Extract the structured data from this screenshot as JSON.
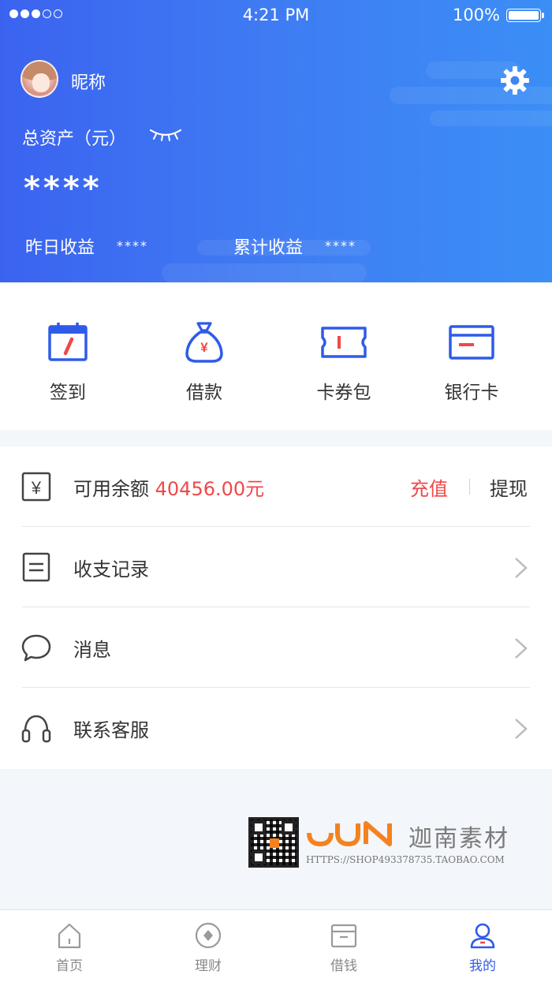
{
  "status_bar": {
    "time": "4:21 PM",
    "battery": "100%"
  },
  "profile": {
    "nickname": "昵称"
  },
  "assets": {
    "label": "总资产（元）",
    "value": "****",
    "yesterday_label": "昨日收益",
    "yesterday_value": "****",
    "cumulative_label": "累计收益",
    "cumulative_value": "****"
  },
  "quick_actions": [
    {
      "label": "签到",
      "icon": "calendar-icon"
    },
    {
      "label": "借款",
      "icon": "money-bag-icon"
    },
    {
      "label": "卡券包",
      "icon": "ticket-icon"
    },
    {
      "label": "银行卡",
      "icon": "bank-card-icon"
    }
  ],
  "balance": {
    "label": "可用余额",
    "amount": "40456.00元",
    "recharge": "充值",
    "withdraw": "提现"
  },
  "menu": [
    {
      "label": "收支记录",
      "icon": "record-icon"
    },
    {
      "label": "消息",
      "icon": "message-icon"
    },
    {
      "label": "联系客服",
      "icon": "headset-icon"
    }
  ],
  "watermark": {
    "brand": "迦南素材",
    "url": "HTTPS://SHOP493378735.TAOBAO.COM"
  },
  "tabbar": [
    {
      "label": "首页",
      "icon": "home-icon",
      "active": false
    },
    {
      "label": "理财",
      "icon": "finance-icon",
      "active": false
    },
    {
      "label": "借钱",
      "icon": "loan-icon",
      "active": false
    },
    {
      "label": "我的",
      "icon": "user-icon",
      "active": true
    }
  ],
  "colors": {
    "primary": "#3b6ff1",
    "accent_red": "#f04848",
    "active_tab": "#2f5be8"
  }
}
